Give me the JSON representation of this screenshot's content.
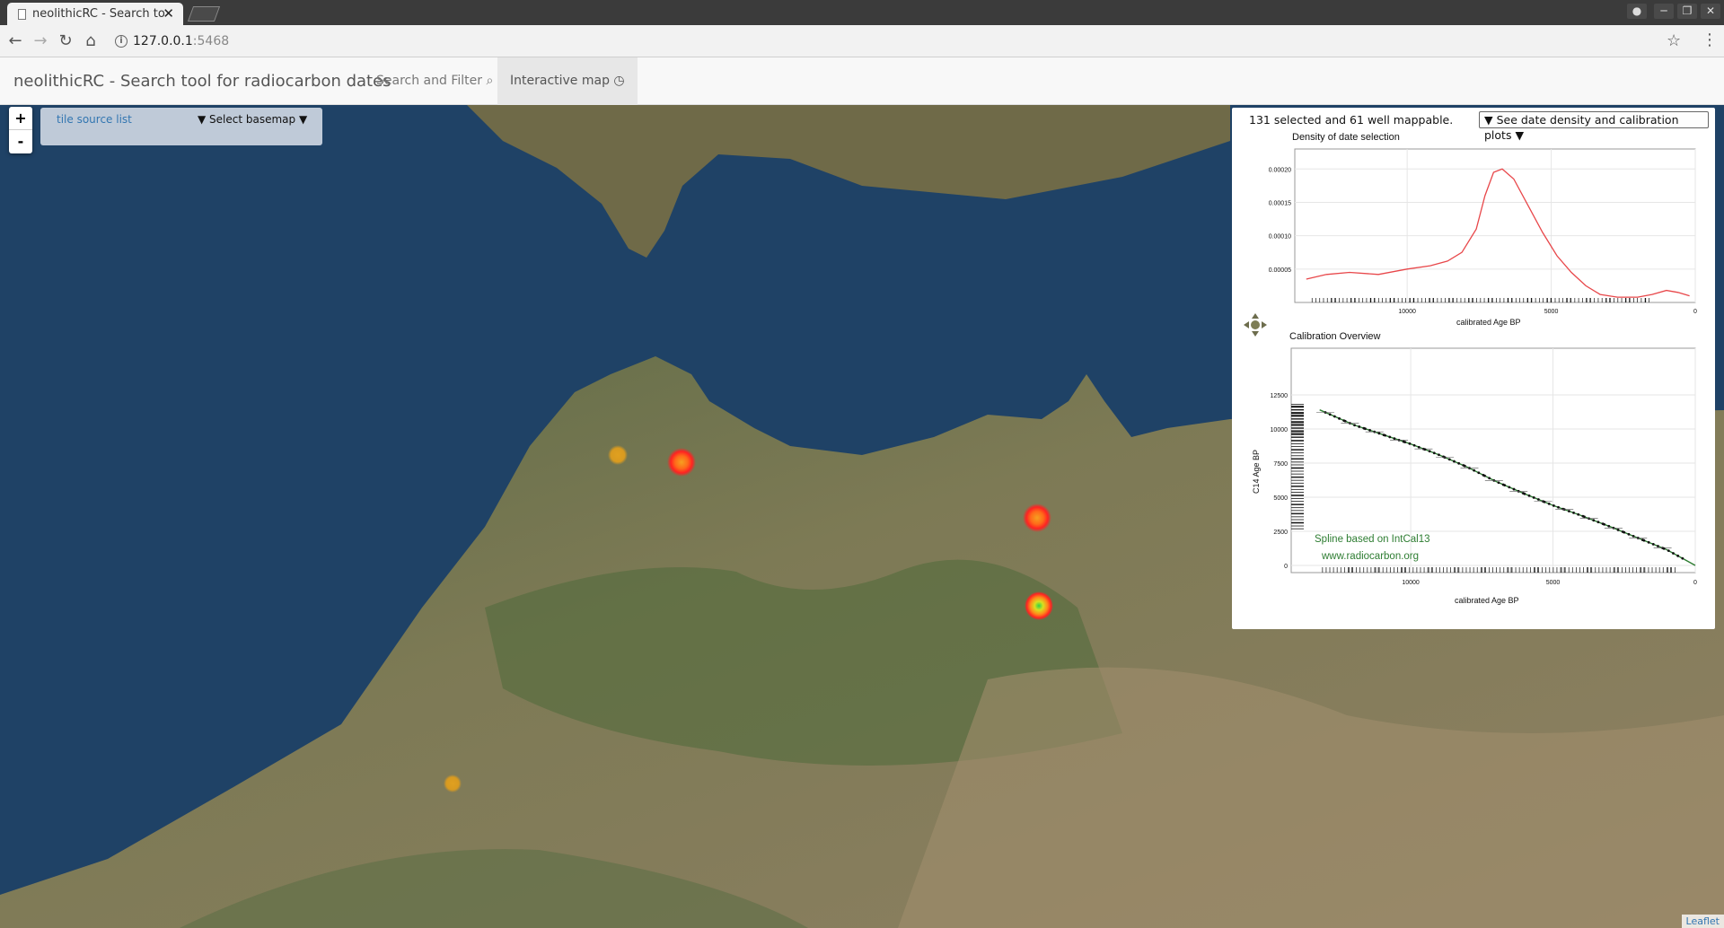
{
  "browser": {
    "tab_title": "neolithicRC - Search to",
    "url_host": "127.0.0.1",
    "url_port": ":5468"
  },
  "navbar": {
    "brand": "neolithicRC - Search tool for radiocarbon dates",
    "tabs": [
      {
        "label": "Search and Filter ⌕",
        "active": false
      },
      {
        "label": "Interactive map ◷",
        "active": true
      }
    ]
  },
  "map": {
    "zoom_in": "+",
    "zoom_out": "-",
    "tile_source_link": "tile source list",
    "basemap_select": "▼ Select basemap ▼",
    "attribution": "Leaflet",
    "markers": [
      {
        "type": "heat-small-yellow"
      },
      {
        "type": "heat-red"
      },
      {
        "type": "heat-red-orange"
      },
      {
        "type": "heat-green-center"
      },
      {
        "type": "heat-small-orange"
      }
    ]
  },
  "panel": {
    "selection_text": "131 selected and 61 well mappable.",
    "plots_button": "▼ See date density and calibration plots ▼",
    "density_plot": {
      "title": "Density of date selection",
      "xlabel": "calibrated Age BP",
      "y_ticks": [
        "0.00020",
        "0.00015",
        "0.00010",
        "0.00005"
      ],
      "x_ticks": [
        "10000",
        "5000",
        "0"
      ]
    },
    "calibration_plot": {
      "title": "Calibration Overview",
      "xlabel": "calibrated Age BP",
      "ylabel": "C14 Age BP",
      "y_ticks": [
        "12500",
        "10000",
        "7500",
        "5000",
        "2500",
        "0"
      ],
      "x_ticks": [
        "10000",
        "5000",
        "0"
      ],
      "note_line1": "Spline based on IntCal13",
      "note_line2": "www.radiocarbon.org"
    }
  },
  "chart_data": [
    {
      "type": "line",
      "title": "Density of date selection",
      "xlabel": "calibrated Age BP",
      "ylabel": "",
      "x_reversed": true,
      "xlim": [
        13900,
        0
      ],
      "ylim": [
        0,
        0.00023
      ],
      "color": "#e8474a",
      "x": [
        13500,
        12800,
        12000,
        11000,
        10000,
        9200,
        8600,
        8100,
        7600,
        7300,
        7000,
        6700,
        6300,
        5800,
        5300,
        4800,
        4300,
        3800,
        3300,
        2700,
        2000,
        1500,
        1000,
        600,
        200
      ],
      "y": [
        3.5e-05,
        4.2e-05,
        4.5e-05,
        4.2e-05,
        5e-05,
        5.5e-05,
        6.2e-05,
        7.5e-05,
        0.00011,
        0.00016,
        0.000195,
        0.0002,
        0.000185,
        0.000145,
        0.000105,
        7e-05,
        4.5e-05,
        2.5e-05,
        1.2e-05,
        8e-06,
        8e-06,
        1.2e-05,
        1.8e-05,
        1.5e-05,
        1e-05
      ]
    },
    {
      "type": "line",
      "title": "Calibration Overview",
      "xlabel": "calibrated Age BP",
      "ylabel": "C14 Age BP",
      "x_reversed": true,
      "xlim": [
        14200,
        0
      ],
      "ylim": [
        0,
        12500
      ],
      "color": "#2e7d32",
      "x": [
        13200,
        12000,
        11000,
        10000,
        9000,
        8000,
        7000,
        6000,
        5000,
        4000,
        3000,
        2000,
        1000,
        0
      ],
      "y": [
        11400,
        10300,
        9600,
        8900,
        8100,
        7200,
        6150,
        5250,
        4400,
        3650,
        2850,
        2000,
        1150,
        0
      ]
    }
  ]
}
